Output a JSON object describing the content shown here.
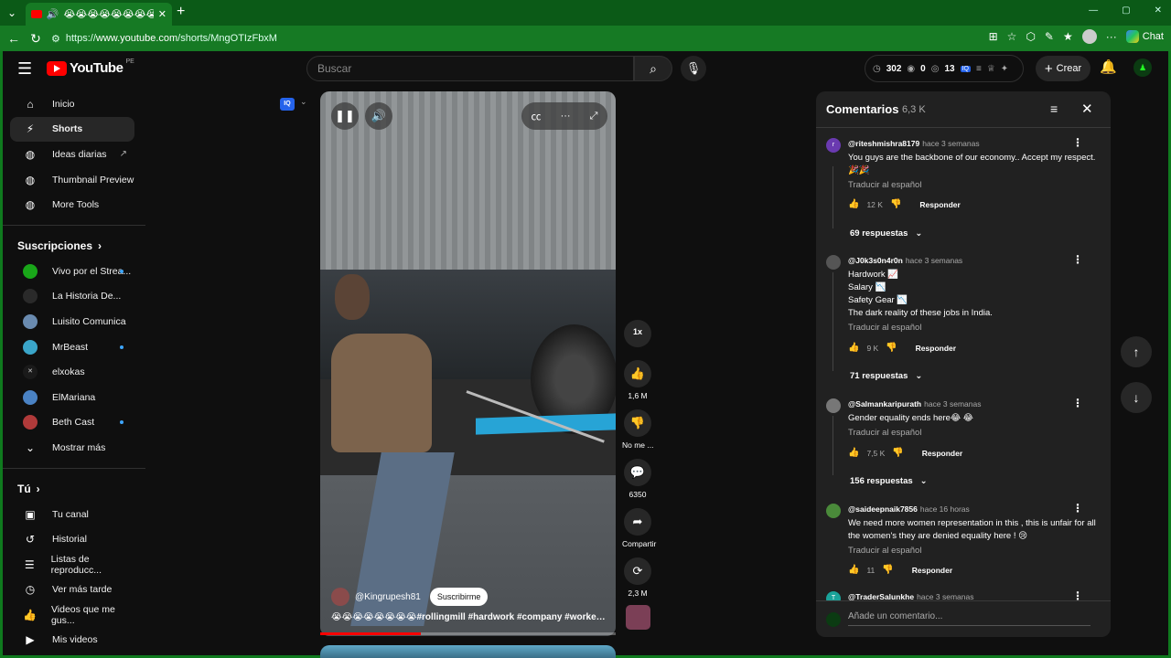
{
  "browser": {
    "tab_title": "😭😭😭😭😭😭😭😭#rolli",
    "url_prefix": "https://",
    "url_host": "www.youtube.com",
    "url_path": "/shorts/MngOTIzFbxM",
    "chat_label": "Chat"
  },
  "masthead": {
    "logo_text": "YouTube",
    "country_code": "PE",
    "search_placeholder": "Buscar",
    "stats": [
      "302",
      "0",
      "13"
    ],
    "create_label": "Crear"
  },
  "sidebar": {
    "main": [
      {
        "label": "Inicio",
        "icon": "home-icon"
      },
      {
        "label": "Shorts",
        "icon": "shorts-icon"
      },
      {
        "label": "Ideas diarias",
        "icon": "iq-icon"
      },
      {
        "label": "Thumbnail Preview",
        "icon": "iq-icon"
      },
      {
        "label": "More Tools",
        "icon": "iq-icon"
      }
    ],
    "subs_title": "Suscripciones",
    "subs": [
      {
        "label": "Vivo por el Strea...",
        "color": "#19a619",
        "dot": true
      },
      {
        "label": "La Historia De...",
        "color": "#2a2a2a",
        "dot": false
      },
      {
        "label": "Luisito Comunica",
        "color": "#6a8bb0",
        "dot": false
      },
      {
        "label": "MrBeast",
        "color": "#3aa5c9",
        "dot": true
      },
      {
        "label": "elxokas",
        "color": "#1a1a1a",
        "dot": false
      },
      {
        "label": "ElMariana",
        "color": "#4a82c4",
        "dot": false
      },
      {
        "label": "Beth Cast",
        "color": "#b03a3a",
        "dot": true
      }
    ],
    "show_more": "Mostrar más",
    "you_title": "Tú",
    "you": [
      {
        "label": "Tu canal"
      },
      {
        "label": "Historial"
      },
      {
        "label": "Listas de reproducc..."
      },
      {
        "label": "Ver más tarde"
      },
      {
        "label": "Videos que me gus..."
      },
      {
        "label": "Mis videos"
      }
    ]
  },
  "short": {
    "channel": "@Kingrupesh81",
    "subscribe": "Suscribirme",
    "caption": "😭😭😭😭😭😭😭😭#rollingmill #hardwork #company #workers ...",
    "progress": 0.34,
    "speed": "1x",
    "likes": "1,6 M",
    "dislike": "No me ...",
    "comments": "6350",
    "share": "Compartir",
    "remix": "2,3 M"
  },
  "comments_panel": {
    "title": "Comentarios",
    "count": "6,3 K",
    "items": [
      {
        "user": "@riteshmishra8179",
        "time": "hace 3 semanas",
        "avatar": "r",
        "avatar_color": "#6a3ab0",
        "lines": [
          "You guys are the backbone of our economy..  Accept my respect.",
          "🎉🎉"
        ],
        "translate": "Traducir al español",
        "likes": "12 K",
        "reply": "Responder",
        "replies": "69 respuestas"
      },
      {
        "user": "@J0k3s0n4r0n",
        "time": "hace 3 semanas",
        "avatar": "",
        "avatar_color": "#555555",
        "lines": [
          "Hardwork 📈",
          "Salary 📉",
          "Safety Gear 📉",
          "The dark reality of these jobs in India."
        ],
        "translate": "Traducir al español",
        "likes": "9 K",
        "reply": "Responder",
        "replies": "71 respuestas"
      },
      {
        "user": "@Salmankaripurath",
        "time": "hace 3 semanas",
        "avatar": "",
        "avatar_color": "#777777",
        "lines": [
          "Gender equality ends here😂 😂"
        ],
        "translate": "Traducir al español",
        "likes": "7,5 K",
        "reply": "Responder",
        "replies": "156 respuestas"
      },
      {
        "user": "@saideepnaik7856",
        "time": "hace 16 horas",
        "avatar": "",
        "avatar_color": "#4a8a3a",
        "lines": [
          "We need more women representation in this , this is unfair for all",
          "the women's they are denied equality here ! 😢"
        ],
        "translate": "Traducir al español",
        "likes": "11",
        "reply": "Responder",
        "replies": ""
      },
      {
        "user": "@TraderSalunkhe",
        "time": "hace 3 semanas",
        "avatar": "T",
        "avatar_color": "#1aa39a",
        "lines": [],
        "translate": "",
        "likes": "",
        "reply": "",
        "replies": ""
      }
    ],
    "add_placeholder": "Añade un comentario..."
  }
}
